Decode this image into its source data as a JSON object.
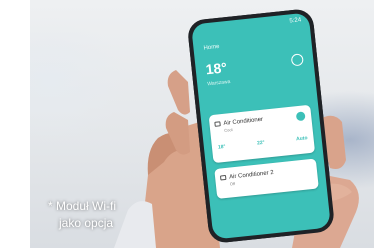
{
  "caption": {
    "line1": "* Moduł Wi-fi",
    "line2": "jako opcja"
  },
  "phone": {
    "temperature": "18°",
    "card1_title": "Air Conditioner",
    "card2_title": "Air Conditioner 2"
  },
  "colors": {
    "app_teal": "#3cc0b8",
    "caption_text": "#ffffff"
  }
}
